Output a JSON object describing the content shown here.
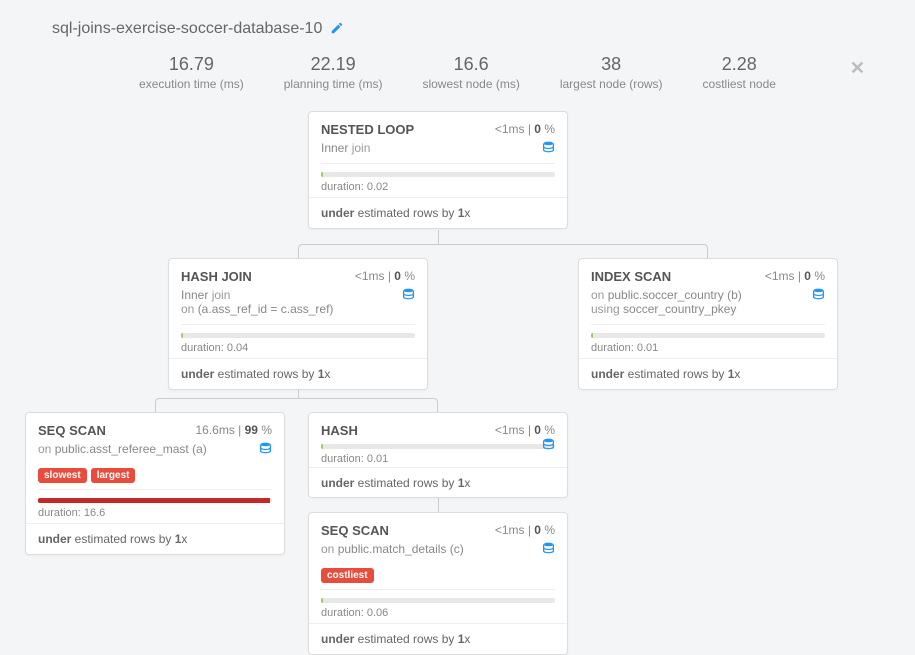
{
  "header": {
    "title": "sql-joins-exercise-soccer-database-10"
  },
  "stats": {
    "exec_time_val": "16.79",
    "exec_time_lbl": "execution time (ms)",
    "plan_time_val": "22.19",
    "plan_time_lbl": "planning time (ms)",
    "slowest_val": "16.6",
    "slowest_lbl": "slowest node (ms)",
    "largest_val": "38",
    "largest_lbl": "largest node (rows)",
    "costliest_val": "2.28",
    "costliest_lbl": "costliest node"
  },
  "nodes": {
    "nestedloop": {
      "title": "NESTED LOOP",
      "metrics_pre": "<1",
      "metrics_unit": "ms | ",
      "metrics_pct": "0",
      "metrics_suffix": " %",
      "sub1": "Inner",
      "sub1b": " join",
      "dur": "duration: 0.02",
      "foot_a": "under",
      "foot_b": " estimated rows by ",
      "foot_c": "1",
      "foot_d": "x"
    },
    "hashjoin": {
      "title": "HASH JOIN",
      "metrics_pre": "<1",
      "metrics_unit": "ms | ",
      "metrics_pct": "0",
      "metrics_suffix": " %",
      "sub1": "Inner",
      "sub1b": " join",
      "sub2a": "on ",
      "sub2b": "(a.ass_ref_id = c.ass_ref)",
      "dur": "duration: 0.04",
      "foot_a": "under",
      "foot_b": " estimated rows by ",
      "foot_c": "1",
      "foot_d": "x"
    },
    "indexscan": {
      "title": "INDEX SCAN",
      "metrics_pre": "<1",
      "metrics_unit": "ms | ",
      "metrics_pct": "0",
      "metrics_suffix": " %",
      "sub1a": "on ",
      "sub1b": "public.soccer_country (b)",
      "sub2a": "using ",
      "sub2b": "soccer_country_pkey",
      "dur": "duration: 0.01",
      "foot_a": "under",
      "foot_b": " estimated rows by ",
      "foot_c": "1",
      "foot_d": "x"
    },
    "seqscan1": {
      "title": "SEQ SCAN",
      "metrics_pre": "16.6",
      "metrics_unit": "ms | ",
      "metrics_pct": "99",
      "metrics_suffix": " %",
      "sub1a": "on ",
      "sub1b": "public.asst_referee_mast (a)",
      "tag_slowest": "slowest",
      "tag_largest": "largest",
      "dur": "duration: 16.6",
      "foot_a": "under",
      "foot_b": " estimated rows by ",
      "foot_c": "1",
      "foot_d": "x"
    },
    "hash": {
      "title": "HASH",
      "metrics_pre": "<1",
      "metrics_unit": "ms | ",
      "metrics_pct": "0",
      "metrics_suffix": " %",
      "dur": "duration: 0.01",
      "foot_a": "under",
      "foot_b": " estimated rows by ",
      "foot_c": "1",
      "foot_d": "x"
    },
    "seqscan2": {
      "title": "SEQ SCAN",
      "metrics_pre": "<1",
      "metrics_unit": "ms | ",
      "metrics_pct": "0",
      "metrics_suffix": " %",
      "sub1a": "on ",
      "sub1b": "public.match_details (c)",
      "tag_costliest": "costliest",
      "dur": "duration: 0.06",
      "foot_a": "under",
      "foot_b": " estimated rows by ",
      "foot_c": "1",
      "foot_d": "x"
    }
  }
}
